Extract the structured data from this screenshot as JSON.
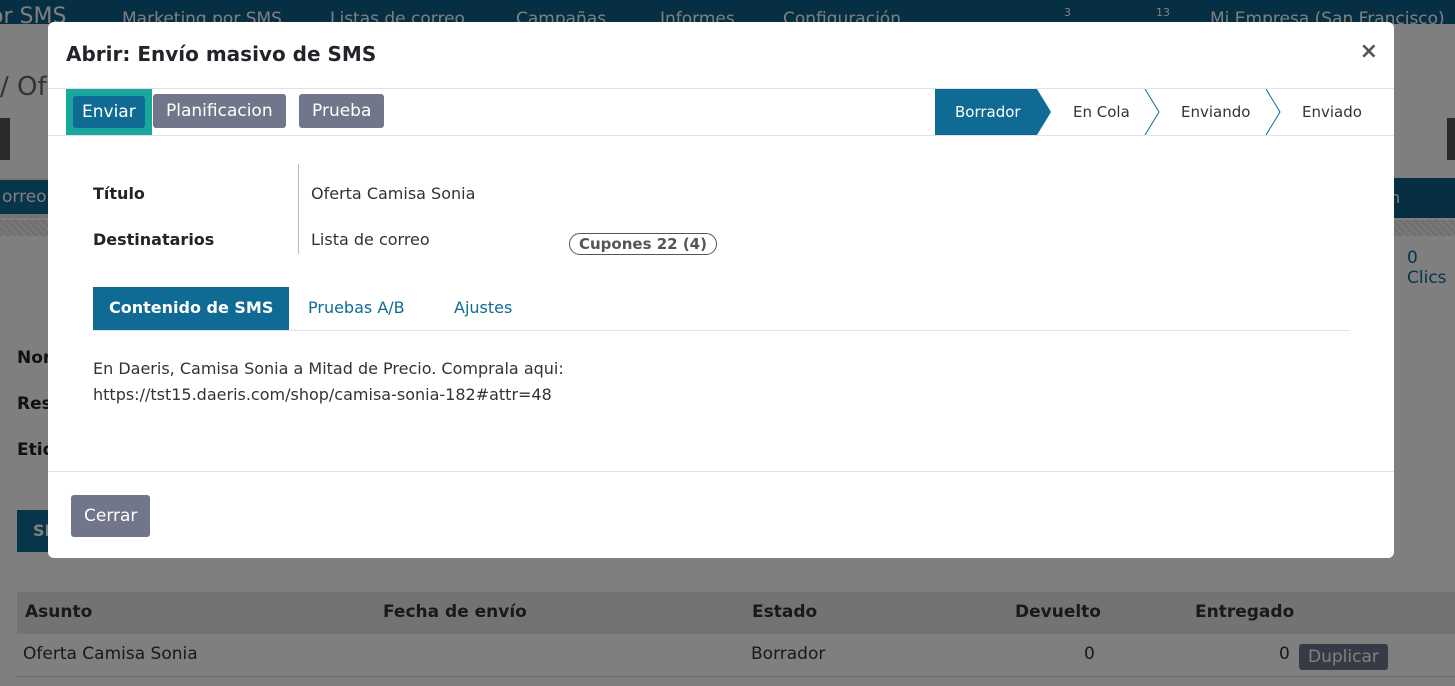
{
  "background": {
    "brand": "or SMS",
    "menu": [
      "Marketing por SMS",
      "Listas de correo",
      "Campañas",
      "Informes",
      "Configuración"
    ],
    "badges": [
      "3",
      "13"
    ],
    "company": "Mi Empresa (San Francisco)",
    "breadcrumb": "/ Ofe",
    "chip_left": "orreo I",
    "chip_right": "n",
    "stat_value": "0",
    "stat_label": "Clics",
    "fields": [
      "Nor",
      "Res",
      "Etiq"
    ],
    "sms_tab": "SI",
    "table": {
      "headers": [
        "Asunto",
        "Fecha de envío",
        "Estado",
        "Devuelto",
        "Entregado"
      ],
      "rows": [
        {
          "asunto": "Oferta Camisa Sonia",
          "fecha": "",
          "estado": "Borrador",
          "devuelto": "0",
          "entregado": "0",
          "action": "Duplicar"
        }
      ]
    }
  },
  "modal": {
    "title": "Abrir: Envío masivo de SMS",
    "close_icon": "close-icon",
    "buttons": {
      "send": "Enviar",
      "schedule": "Planificacion",
      "test": "Prueba"
    },
    "stages": [
      {
        "label": "Borrador",
        "active": true
      },
      {
        "label": "En Cola",
        "active": false
      },
      {
        "label": "Enviando",
        "active": false
      },
      {
        "label": "Enviado",
        "active": false
      }
    ],
    "form": {
      "title_label": "Título",
      "title_value": "Oferta Camisa Sonia",
      "recipients_label": "Destinatarios",
      "recipients_value": "Lista de correo",
      "mailing_tag": "Cupones 22 (4)"
    },
    "tabs": [
      {
        "label": "Contenido de SMS",
        "active": true
      },
      {
        "label": "Pruebas A/B",
        "active": false
      },
      {
        "label": "Ajustes",
        "active": false
      }
    ],
    "content": {
      "line1": "En Daeris, Camisa Sonia a Mitad de Precio. Comprala aqui:",
      "line2": "https://tst15.daeris.com/shop/camisa-sonia-182#attr=48"
    },
    "footer": {
      "close": "Cerrar"
    }
  },
  "colors": {
    "primary": "#0f6a94",
    "secondary": "#71768a",
    "highlight": "#19a7a0"
  }
}
